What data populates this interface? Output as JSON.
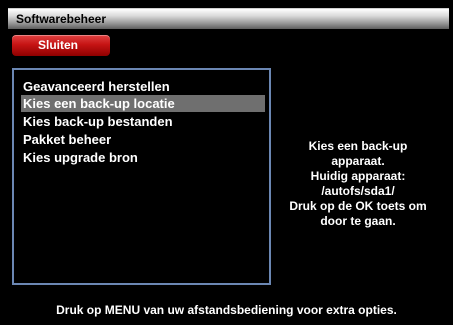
{
  "window": {
    "title": "Softwarebeheer"
  },
  "buttons": {
    "red_label": "Sluiten"
  },
  "menu": {
    "items": [
      {
        "label": "Geavanceerd herstellen",
        "selected": false
      },
      {
        "label": "Kies een back-up locatie",
        "selected": true
      },
      {
        "label": "Kies back-up bestanden",
        "selected": false
      },
      {
        "label": "Pakket beheer",
        "selected": false
      },
      {
        "label": "Kies upgrade bron",
        "selected": false
      }
    ]
  },
  "info": {
    "lines": [
      "Kies een back-up",
      "apparaat.",
      "Huidig apparaat:",
      "/autofs/sda1/",
      "Druk op de OK toets om",
      "door te gaan."
    ]
  },
  "footer": {
    "hint": "Druk op MENU van uw afstandsbediening voor extra opties."
  },
  "colors": {
    "background": "#000000",
    "selection": "#6f6f6f",
    "panel_border": "#6b87b3",
    "red_button": "#c61414"
  }
}
